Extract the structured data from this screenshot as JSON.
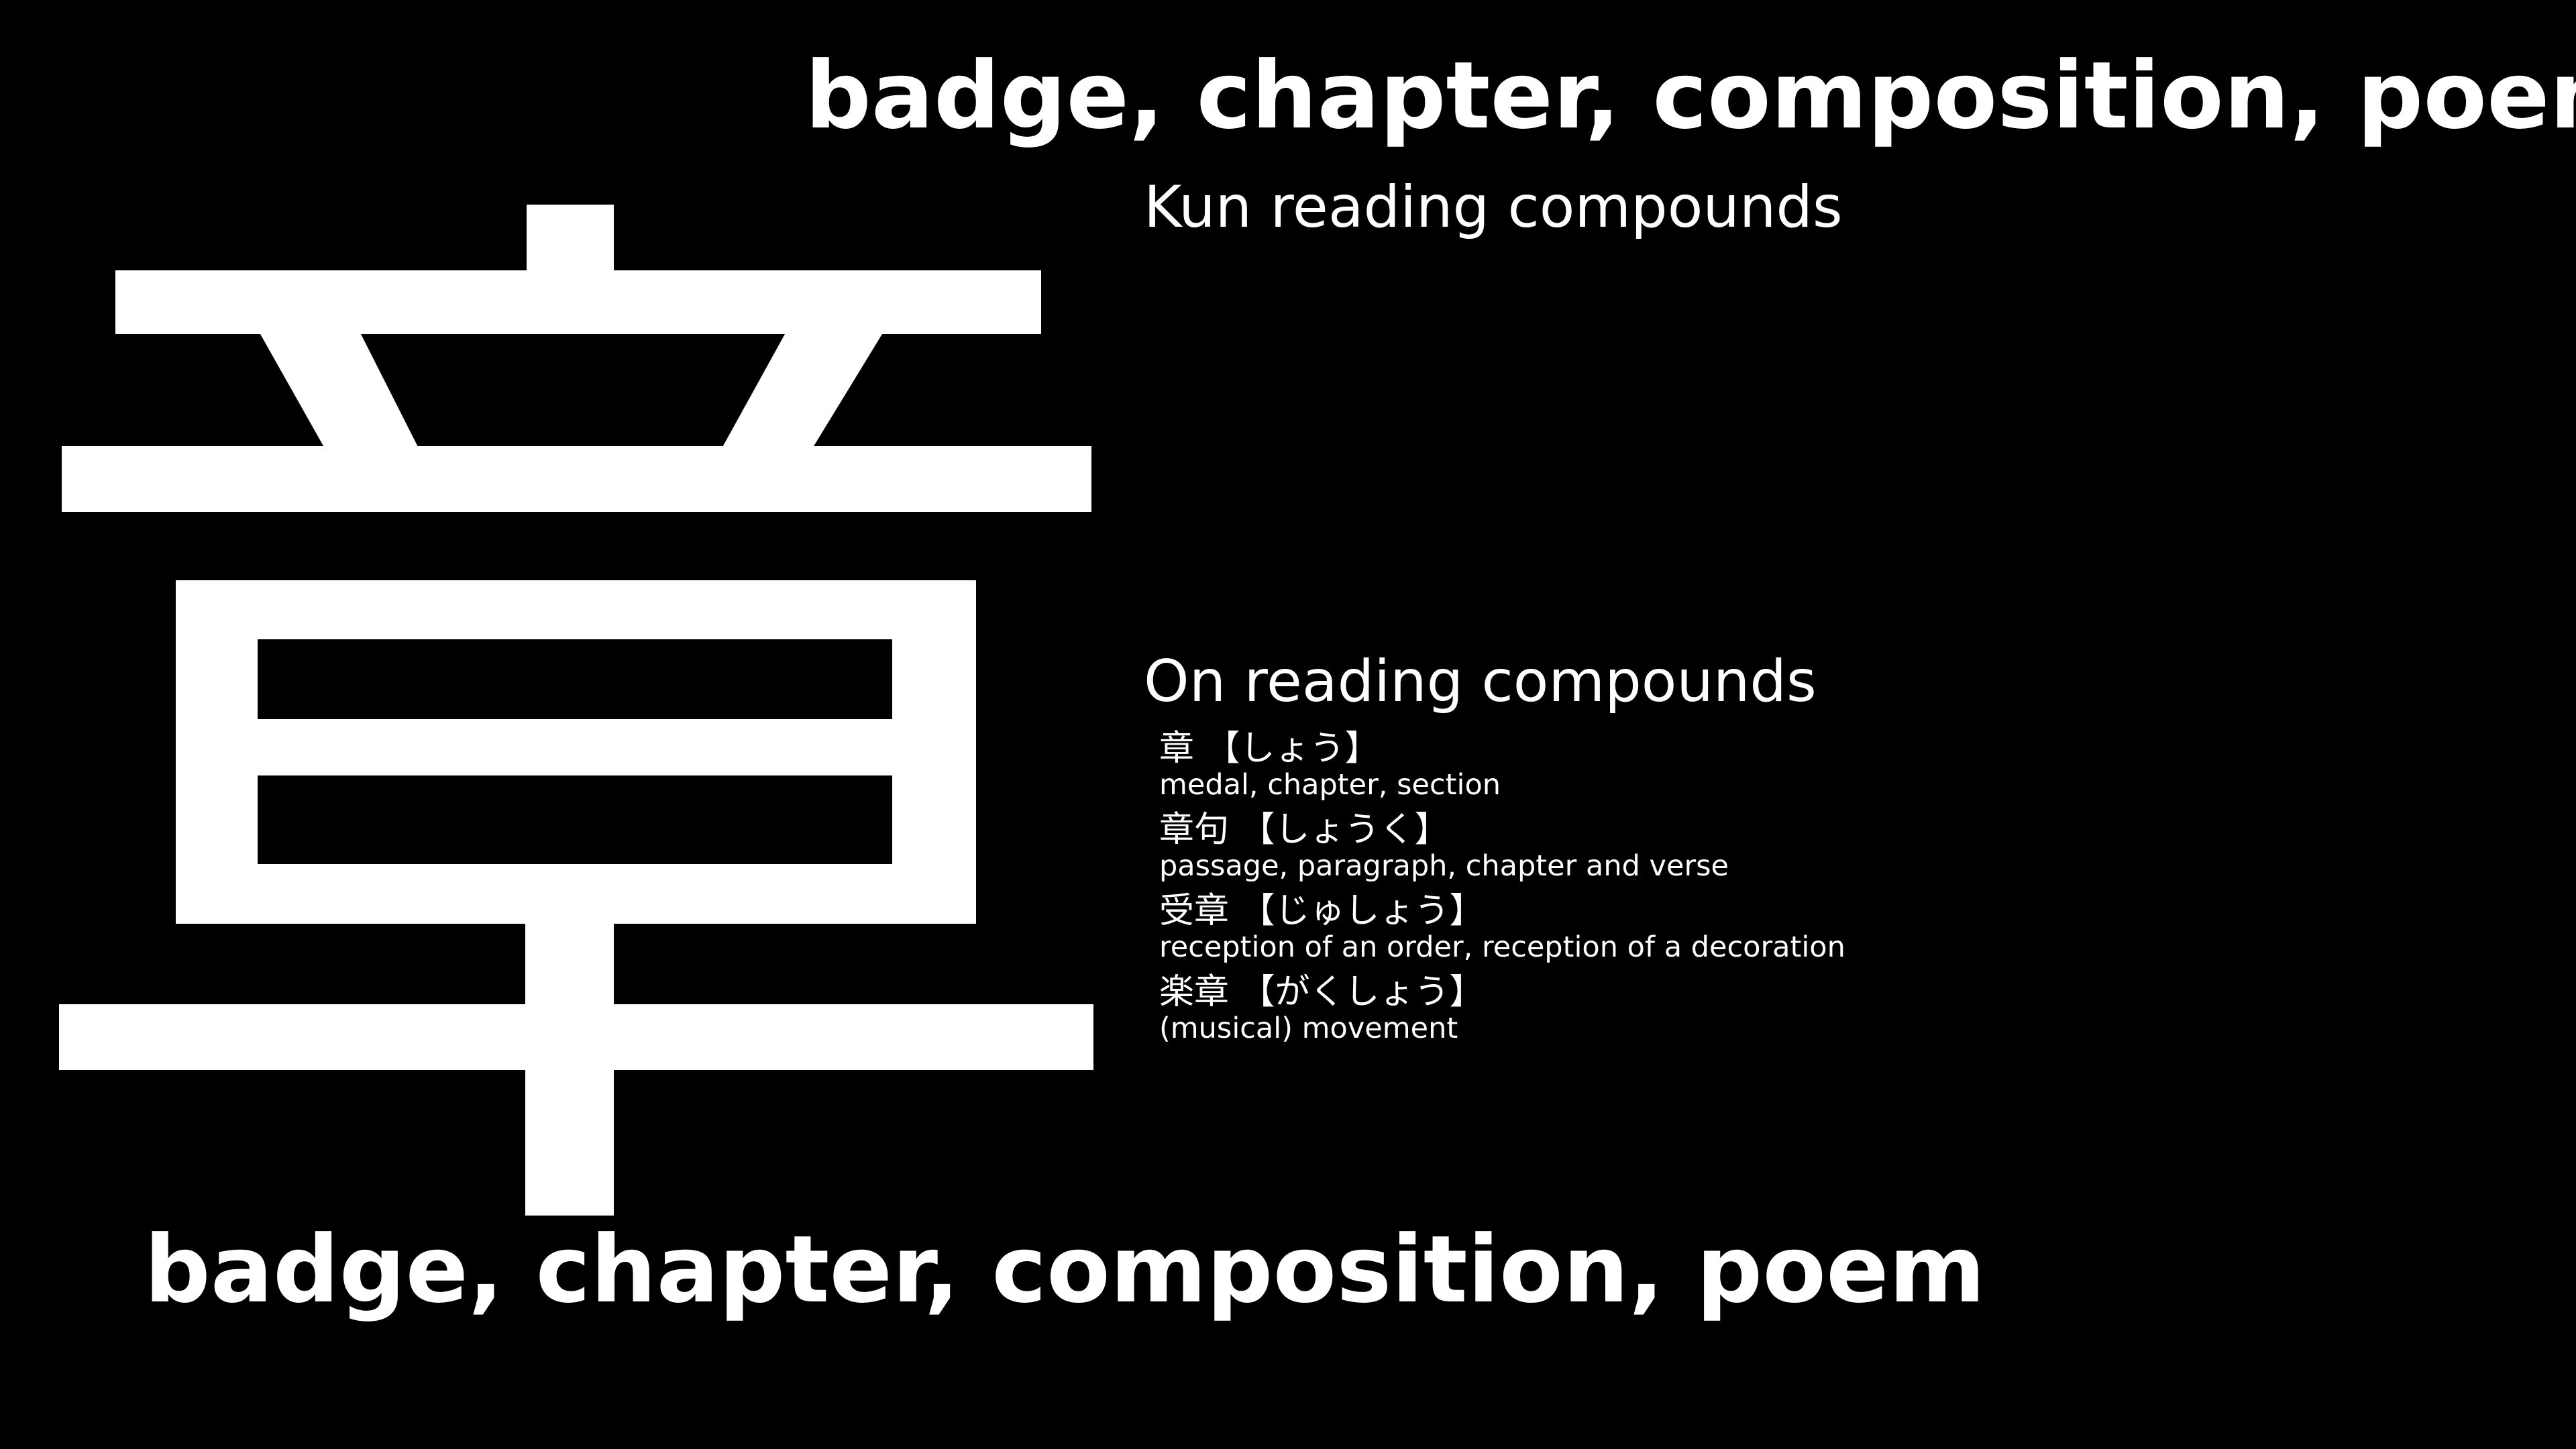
{
  "kanji": {
    "character": "章"
  },
  "meaning_top": "badge, chapter, composition, poem",
  "meaning_bottom": "badge, chapter, composition, poem",
  "kun_heading": "Kun reading compounds",
  "on_heading": "On reading compounds",
  "on_compounds": [
    {
      "word": "章 【しょう】",
      "meaning": "medal, chapter, section"
    },
    {
      "word": "章句 【しょうく】",
      "meaning": "passage, paragraph, chapter and verse"
    },
    {
      "word": "受章 【じゅしょう】",
      "meaning": "reception of an order, reception of a decoration"
    },
    {
      "word": "楽章 【がくしょう】",
      "meaning": "(musical) movement"
    }
  ],
  "colors": {
    "background": "#000000",
    "text": "#ffffff"
  }
}
